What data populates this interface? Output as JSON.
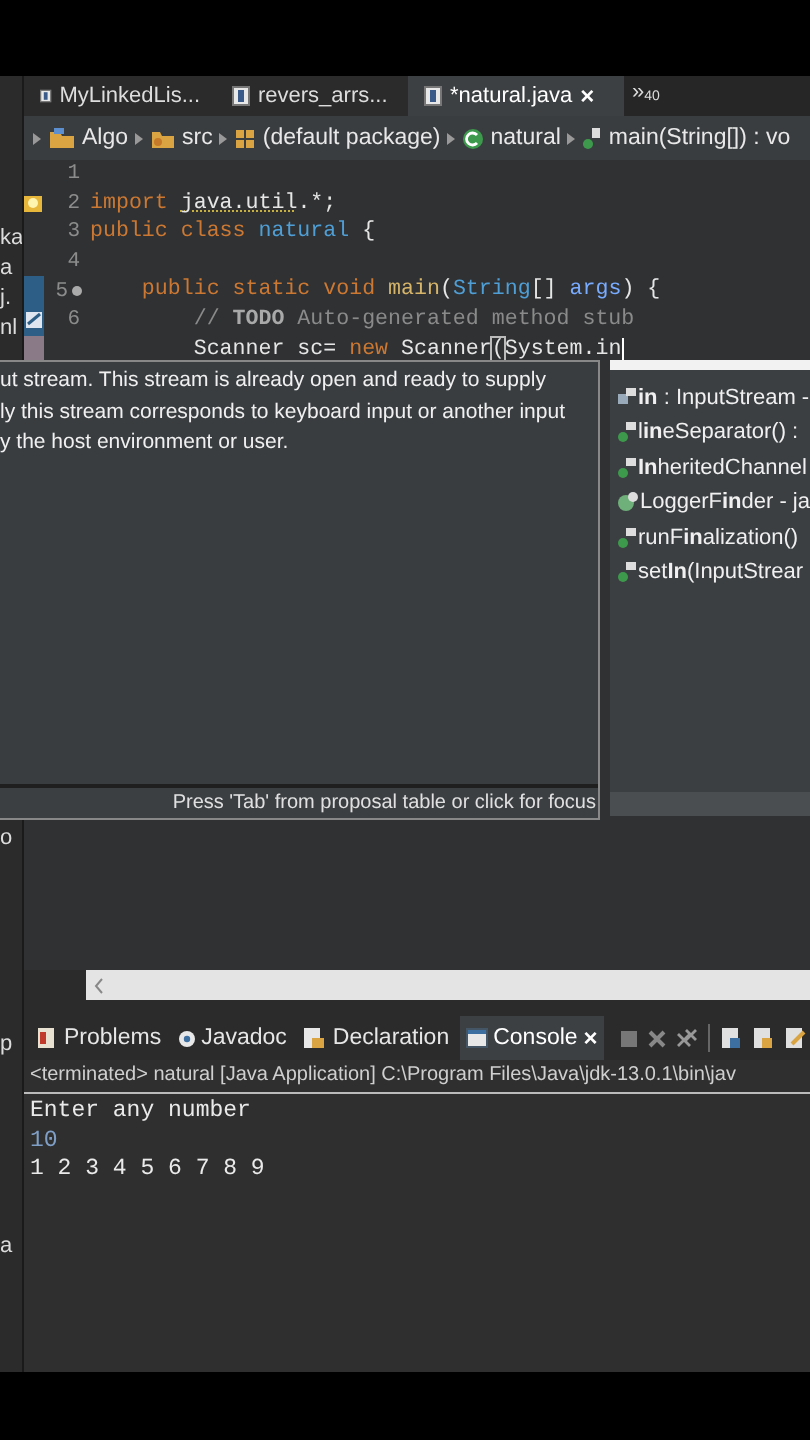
{
  "left_panel": {
    "fragments": [
      "ka",
      "a",
      "j.",
      "nl",
      "o",
      "p",
      "a"
    ]
  },
  "editor_tabs": [
    {
      "label": "MyLinkedLis...",
      "selected": false
    },
    {
      "label": "revers_arrs...",
      "selected": false
    },
    {
      "label": "*natural.java",
      "selected": true,
      "close": "×"
    }
  ],
  "tab_overflow": {
    "chevron": "»",
    "count": "40"
  },
  "breadcrumb": [
    {
      "label": "Algo",
      "kind": "project"
    },
    {
      "label": "src",
      "kind": "folder"
    },
    {
      "label": "(default package)",
      "kind": "package"
    },
    {
      "label": "natural",
      "kind": "class"
    },
    {
      "label": "main(String[]) : vo",
      "kind": "method"
    }
  ],
  "code_lines": [
    {
      "number": "1"
    },
    {
      "number": "2",
      "warning": true,
      "tokens": [
        {
          "text": "import ",
          "kind": "keyword"
        },
        {
          "text": "java.util",
          "kind": "warning"
        },
        {
          "text": ".*;",
          "kind": "plain"
        }
      ]
    },
    {
      "number": "3",
      "tokens": [
        {
          "text": "public class ",
          "kind": "keyword"
        },
        {
          "text": "natural",
          "kind": "type"
        },
        {
          "text": " {",
          "kind": "plain"
        }
      ]
    },
    {
      "number": "4"
    },
    {
      "number": "5",
      "override": true,
      "tokens": [
        {
          "text": "    public static void ",
          "kind": "keyword"
        },
        {
          "text": "main",
          "kind": "method"
        },
        {
          "text": "(",
          "kind": "plain"
        },
        {
          "text": "String",
          "kind": "type"
        },
        {
          "text": "[] ",
          "kind": "plain"
        },
        {
          "text": "args",
          "kind": "param"
        },
        {
          "text": ") {",
          "kind": "plain"
        }
      ]
    },
    {
      "number": "6",
      "task": true,
      "tokens": [
        {
          "text": "        // ",
          "kind": "comment"
        },
        {
          "text": "TODO",
          "kind": "todo"
        },
        {
          "text": " Auto-generated method stub",
          "kind": "comment"
        }
      ]
    },
    {
      "changed": true,
      "cursor": true,
      "tokens": [
        {
          "text": "        Scanner sc= ",
          "kind": "plain"
        },
        {
          "text": "new",
          "kind": "keyword"
        },
        {
          "text": " Scanner",
          "kind": "plain"
        },
        {
          "text": "(",
          "kind": "bracket"
        },
        {
          "text": "System.in",
          "kind": "plain"
        }
      ]
    }
  ],
  "javadoc_popup": {
    "lines": [
      "ut stream. This stream is already open and ready to supply",
      "ly this stream corresponds to keyboard input or another input",
      "y the host environment or user."
    ],
    "footer": "Press 'Tab' from proposal table or click for focus"
  },
  "proposals": [
    {
      "label": "**in** : InputStream -",
      "kind": "field"
    },
    {
      "label": "l**in**eSeparator() :",
      "kind": "method"
    },
    {
      "label": "**In**heritedChannel",
      "kind": "method"
    },
    {
      "label": "LoggerF**in**der - ja",
      "kind": "class"
    },
    {
      "label": "runF**in**alization()",
      "kind": "method"
    },
    {
      "label": "set**In**(InputStrear",
      "kind": "method"
    }
  ],
  "view_tabs": [
    {
      "label": "Problems",
      "kind": "problems",
      "selected": false
    },
    {
      "label": "Javadoc",
      "kind": "javadoc",
      "selected": false
    },
    {
      "label": "Declaration",
      "kind": "declaration",
      "selected": false
    },
    {
      "label": "Console",
      "kind": "console",
      "selected": true,
      "close": "×"
    }
  ],
  "console": {
    "header": "<terminated> natural [Java Application] C:\\Program Files\\Java\\jdk-13.0.1\\bin\\jav",
    "lines": [
      {
        "text": "Enter any number",
        "kind": "output"
      },
      {
        "text": "10",
        "kind": "input"
      },
      {
        "text": "1 2 3 4 5 6 7 8 9",
        "kind": "output"
      }
    ]
  }
}
